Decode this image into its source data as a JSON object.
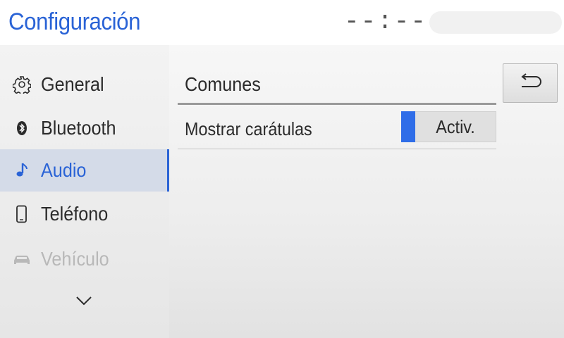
{
  "header": {
    "title": "Configuración",
    "clock": "--:--"
  },
  "sidebar": {
    "items": [
      {
        "label": "General",
        "icon": "gear-icon",
        "state": "normal"
      },
      {
        "label": "Bluetooth",
        "icon": "bluetooth-icon",
        "state": "normal"
      },
      {
        "label": "Audio",
        "icon": "music-note-icon",
        "state": "active"
      },
      {
        "label": "Teléfono",
        "icon": "phone-icon",
        "state": "normal"
      },
      {
        "label": "Vehículo",
        "icon": "car-icon",
        "state": "disabled"
      }
    ],
    "more_icon": "chevron-down-icon"
  },
  "main": {
    "section_title": "Comunes",
    "rows": [
      {
        "label": "Mostrar carátulas",
        "value": "Activ."
      }
    ],
    "back_icon": "back-arrow-icon"
  },
  "colors": {
    "accent": "#2a63d6",
    "toggle_on": "#2f6de8",
    "active_bg": "#d4dbe8",
    "disabled_text": "#b8b8b8"
  }
}
